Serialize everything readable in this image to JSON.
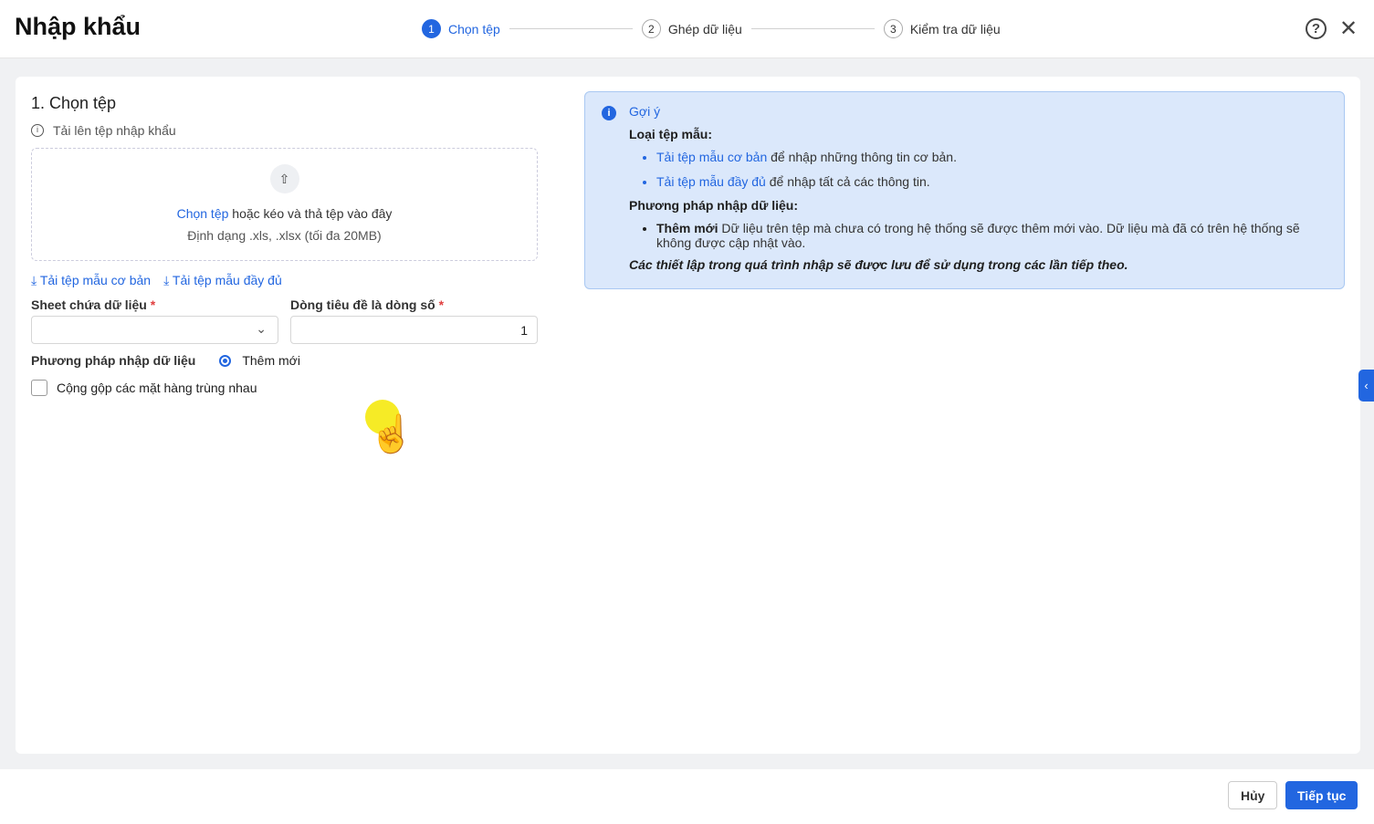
{
  "header": {
    "title": "Nhập khẩu",
    "steps": [
      {
        "num": "1",
        "label": "Chọn tệp"
      },
      {
        "num": "2",
        "label": "Ghép dữ liệu"
      },
      {
        "num": "3",
        "label": "Kiểm tra dữ liệu"
      }
    ]
  },
  "form": {
    "heading": "1. Chọn tệp",
    "upload_label": "Tải lên tệp nhập khẩu",
    "drop_link": "Chọn tệp",
    "drop_text": " hoặc kéo và thả tệp vào đây",
    "drop_format": "Định dạng .xls, .xlsx (tối đa 20MB)",
    "link_basic": "Tải tệp mẫu cơ bản",
    "link_full": "Tải tệp mẫu đầy đủ",
    "sheet_label": "Sheet chứa dữ liệu",
    "header_row_label": "Dòng tiêu đề là dòng số",
    "header_row_value": "1",
    "method_label": "Phương pháp nhập dữ liệu",
    "method_option": "Thêm mới",
    "merge_label": "Cộng gộp các mặt hàng trùng nhau",
    "required": "*"
  },
  "hint": {
    "title": "Gợi ý",
    "type_heading": "Loại tệp mẫu:",
    "basic_link": "Tải tệp mẫu cơ bản",
    "basic_text": " để nhập những thông tin cơ bản.",
    "full_link": "Tải tệp mẫu đầy đủ",
    "full_text": " để nhập tất cả các thông tin.",
    "method_heading": "Phương pháp nhập dữ liệu:",
    "method_name": "Thêm mới",
    "method_text": " Dữ liệu trên tệp mà chưa có trong hệ thống sẽ được thêm mới vào. Dữ liệu mà đã có trên hệ thống sẽ không được cập nhật vào.",
    "note": "Các thiết lập trong quá trình nhập sẽ được lưu để sử dụng trong các lần tiếp theo."
  },
  "footer": {
    "cancel": "Hủy",
    "next": "Tiếp tục"
  }
}
